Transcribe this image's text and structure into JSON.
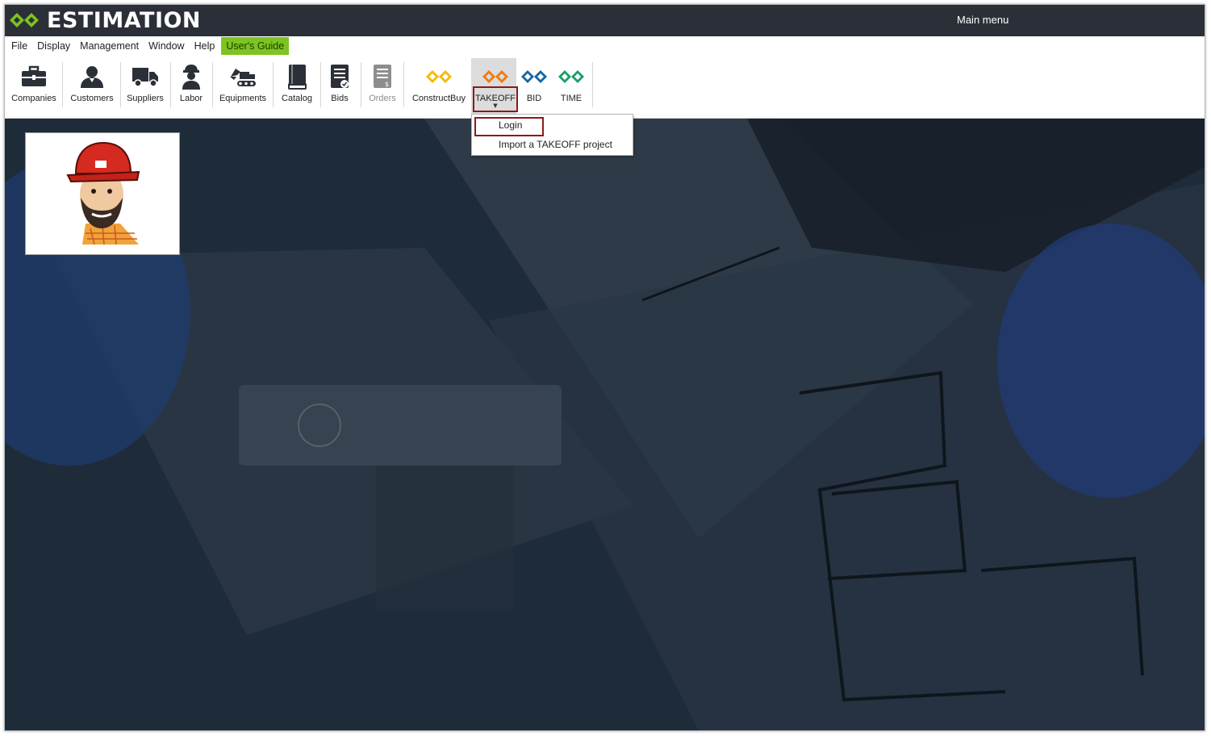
{
  "app": {
    "title": "ESTIMATION",
    "window_title": "Main menu"
  },
  "colors": {
    "titlebar": "#2b3038",
    "brand_green": "#7dc41f",
    "takeoff_orange": "#f07a10",
    "bid_blue": "#1565a8",
    "time_green": "#1a9e6a",
    "constructbuy_yellow": "#f5b800",
    "highlight_red": "#8b1a1a"
  },
  "menubar": {
    "items": [
      "File",
      "Display",
      "Management",
      "Window",
      "Help"
    ],
    "guide_label": "User's Guide"
  },
  "toolbar": {
    "companies": {
      "label": "Companies",
      "icon": "briefcase-icon"
    },
    "customers": {
      "label": "Customers",
      "icon": "person-icon"
    },
    "suppliers": {
      "label": "Suppliers",
      "icon": "truck-icon"
    },
    "labor": {
      "label": "Labor",
      "icon": "worker-icon"
    },
    "equipments": {
      "label": "Equipments",
      "icon": "excavator-icon"
    },
    "catalog": {
      "label": "Catalog",
      "icon": "book-icon"
    },
    "bids": {
      "label": "Bids",
      "icon": "document-check-icon"
    },
    "orders": {
      "label": "Orders",
      "icon": "invoice-icon",
      "disabled": true
    },
    "constructbuy": {
      "label": "ConstructBuy",
      "icon": "constructbuy-logo-icon"
    },
    "takeoff": {
      "label": "TAKEOFF",
      "icon": "takeoff-logo-icon",
      "active": true
    },
    "bid": {
      "label": "BID",
      "icon": "bid-logo-icon"
    },
    "time": {
      "label": "TIME",
      "icon": "time-logo-icon"
    }
  },
  "takeoff_menu": {
    "items": [
      {
        "label": "Login",
        "highlighted": true
      },
      {
        "label": "Import a TAKEOFF project"
      }
    ]
  }
}
